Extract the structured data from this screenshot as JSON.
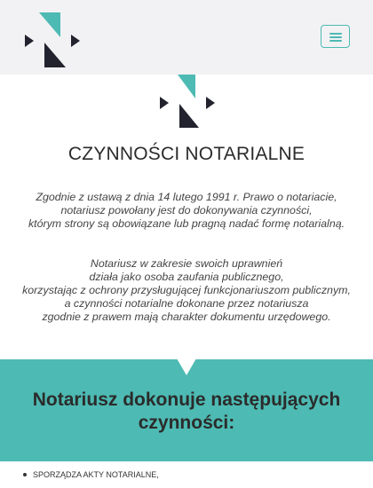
{
  "header": {
    "logo_icon": "notary-n-logo",
    "menu_icon": "hamburger-icon"
  },
  "colors": {
    "accent": "#4dbab3",
    "dark": "#23232f",
    "header_bg": "#f2f2f4"
  },
  "main": {
    "title": "CZYNNOŚCI NOTARIALNE",
    "intro_lines": [
      "Zgodnie z ustawą z dnia 14 lutego 1991 r. Prawo o notariacie,",
      "notariusz powołany jest do dokonywania czynności,",
      "którym strony są obowiązane lub pragną nadać formę notarialną."
    ],
    "intro2_lines": [
      "Notariusz w zakresie swoich uprawnień",
      "działa jako osoba zaufania publicznego,",
      "korzystając z ochrony przysługującej funkcjonariuszom publicznym,",
      "a czynności notarialne dokonane przez notariusza",
      "zgodnie z prawem mają charakter dokumentu urzędowego."
    ]
  },
  "services": {
    "title": "Notariusz dokonuje następujących czynności:",
    "items": [
      "sporządza akty notarialne,"
    ]
  }
}
